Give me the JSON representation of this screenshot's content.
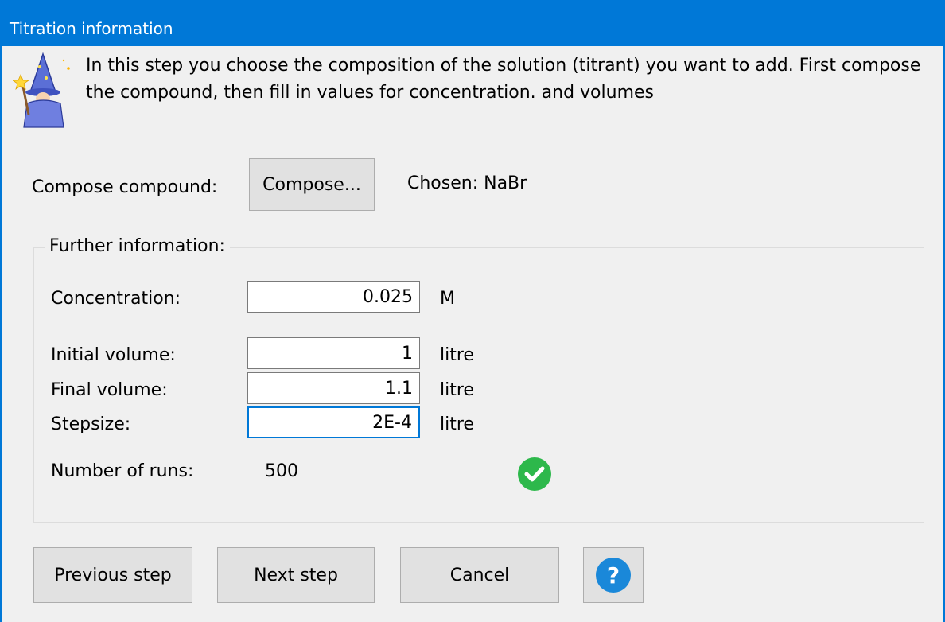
{
  "window": {
    "title": "Titration information"
  },
  "intro": {
    "text": "In this step you choose the composition of the solution (titrant) you want to add. First compose the compound, then fill in values for concentration. and volumes",
    "icon": "wizard-icon"
  },
  "compose": {
    "label": "Compose compound:",
    "button_label": "Compose...",
    "chosen_text": "Chosen: NaBr"
  },
  "further": {
    "group_title": "Further information:",
    "concentration": {
      "label": "Concentration:",
      "value": "0.025",
      "unit": "M"
    },
    "initial_volume": {
      "label": "Initial volume:",
      "value": "1",
      "unit": "litre"
    },
    "final_volume": {
      "label": "Final volume:",
      "value": "1.1",
      "unit": "litre"
    },
    "stepsize": {
      "label": "Stepsize:",
      "value": "2E-4",
      "unit": "litre"
    },
    "runs": {
      "label": "Number of runs:",
      "value": "500",
      "status_icon": "check-circle-icon",
      "status_color": "#2db84b"
    }
  },
  "buttons": {
    "previous": "Previous step",
    "next": "Next step",
    "cancel": "Cancel",
    "help_icon": "question-mark-icon",
    "help_color": "#1a88d9"
  },
  "colors": {
    "titlebar": "#0078d7",
    "background": "#f0f0f0"
  }
}
